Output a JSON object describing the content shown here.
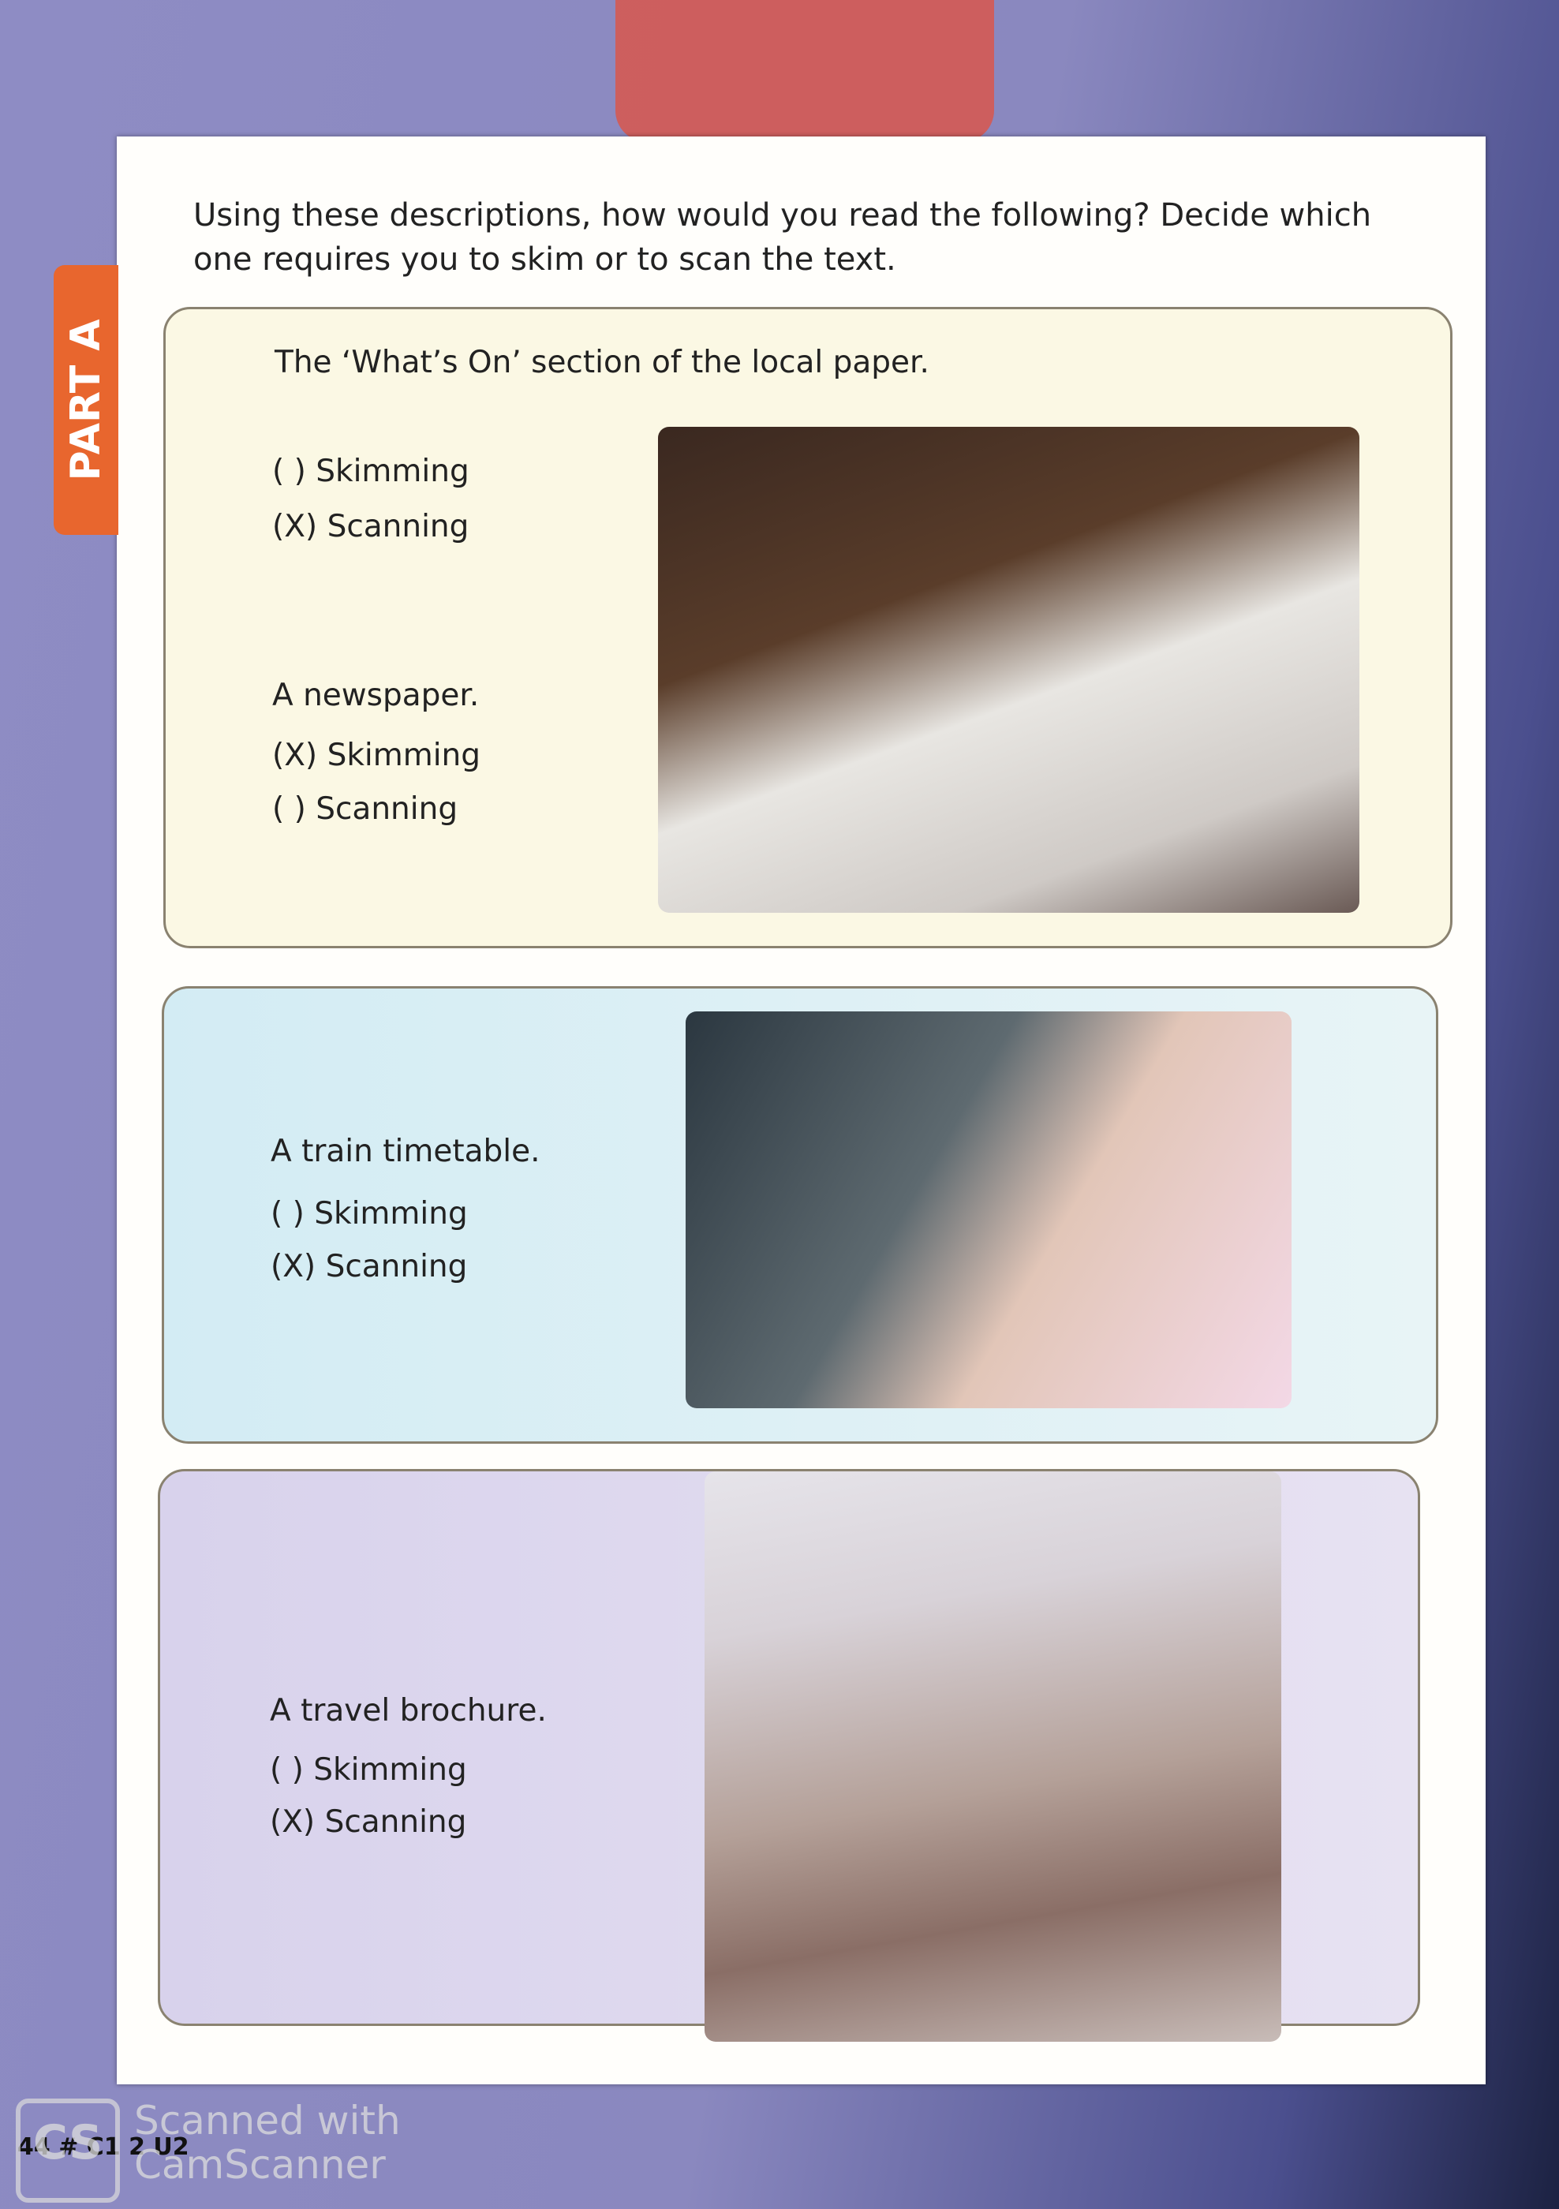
{
  "tab": "PART A",
  "instruction": "Using these descriptions, how would you read the following? Decide which one requires you to skim or to scan the text.",
  "items": [
    {
      "prompt": "The ‘What’s On’ section of the local paper.",
      "options": [
        {
          "mark": "(   )",
          "label": "Skimming"
        },
        {
          "mark": "(X)",
          "label": "Scanning"
        }
      ],
      "answer": "Scanning"
    },
    {
      "prompt": "A newspaper.",
      "options": [
        {
          "mark": "(X)",
          "label": "Skimming"
        },
        {
          "mark": "(   )",
          "label": "Scanning"
        }
      ],
      "answer": "Skimming"
    },
    {
      "prompt": "A train timetable.",
      "options": [
        {
          "mark": "(   )",
          "label": "Skimming"
        },
        {
          "mark": "(X)",
          "label": "Scanning"
        }
      ],
      "answer": "Scanning"
    },
    {
      "prompt": "A travel brochure.",
      "options": [
        {
          "mark": "(   )",
          "label": "Skimming"
        },
        {
          "mark": "(X)",
          "label": "Scanning"
        }
      ],
      "answer": "Scanning"
    }
  ],
  "footer": {
    "page_number": "44 # C1 2 U2"
  },
  "watermark": {
    "logo": "CS",
    "line1": "Scanned with",
    "line2": "CamScanner"
  },
  "colors": {
    "tab": "#e8662e",
    "box1": "#fbf8e4",
    "box2": "#d3ecf4",
    "box3": "#d8d2ec"
  }
}
